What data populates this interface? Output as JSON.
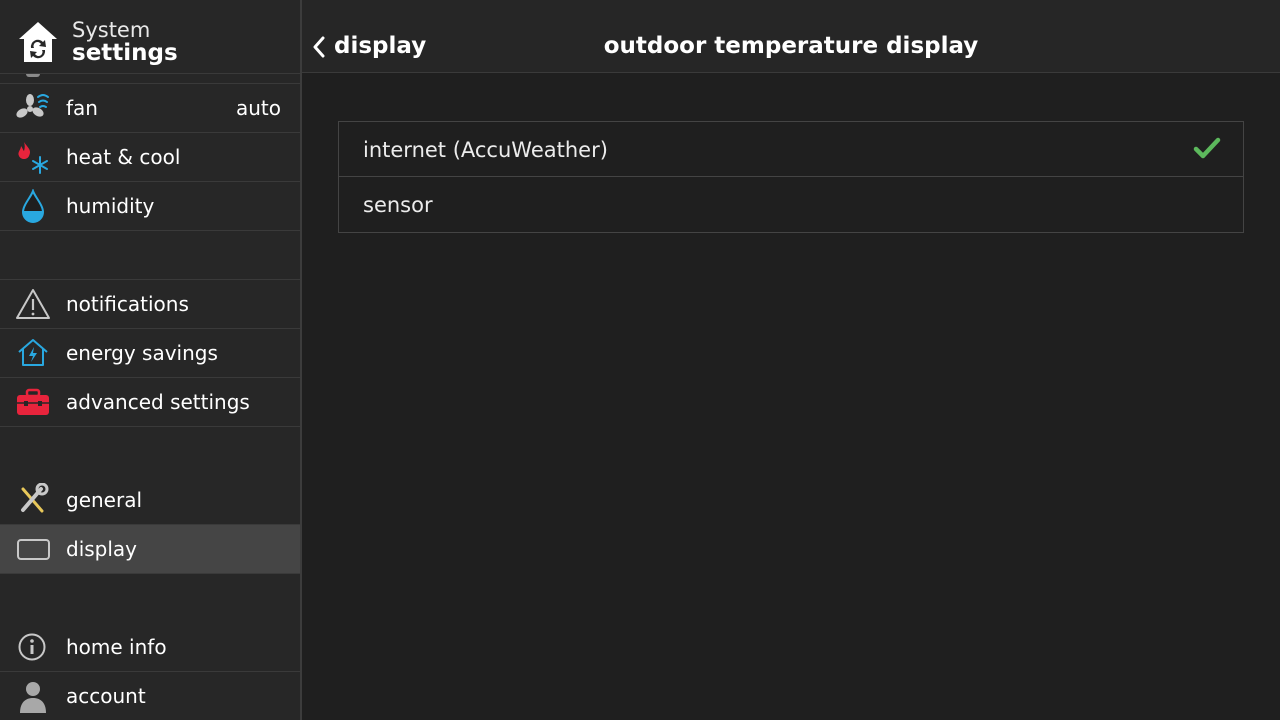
{
  "sidebar": {
    "title_line1": "System",
    "title_line2": "settings",
    "items": [
      {
        "label": "fan",
        "value": "auto"
      },
      {
        "label": "heat & cool"
      },
      {
        "label": "humidity"
      },
      {
        "label": "notifications"
      },
      {
        "label": "energy savings"
      },
      {
        "label": "advanced settings"
      },
      {
        "label": "general"
      },
      {
        "label": "display"
      },
      {
        "label": "home info"
      },
      {
        "label": "account"
      }
    ]
  },
  "header": {
    "back_label": "display",
    "title": "outdoor temperature display"
  },
  "options": [
    {
      "label": "internet (AccuWeather)",
      "selected": true
    },
    {
      "label": "sensor",
      "selected": false
    }
  ],
  "colors": {
    "accent_blue": "#29a8e0",
    "flame_red": "#e8243c",
    "toolbox_red": "#e8243c",
    "check_green": "#5cb85c",
    "wrench_yellow": "#e8c85a"
  }
}
